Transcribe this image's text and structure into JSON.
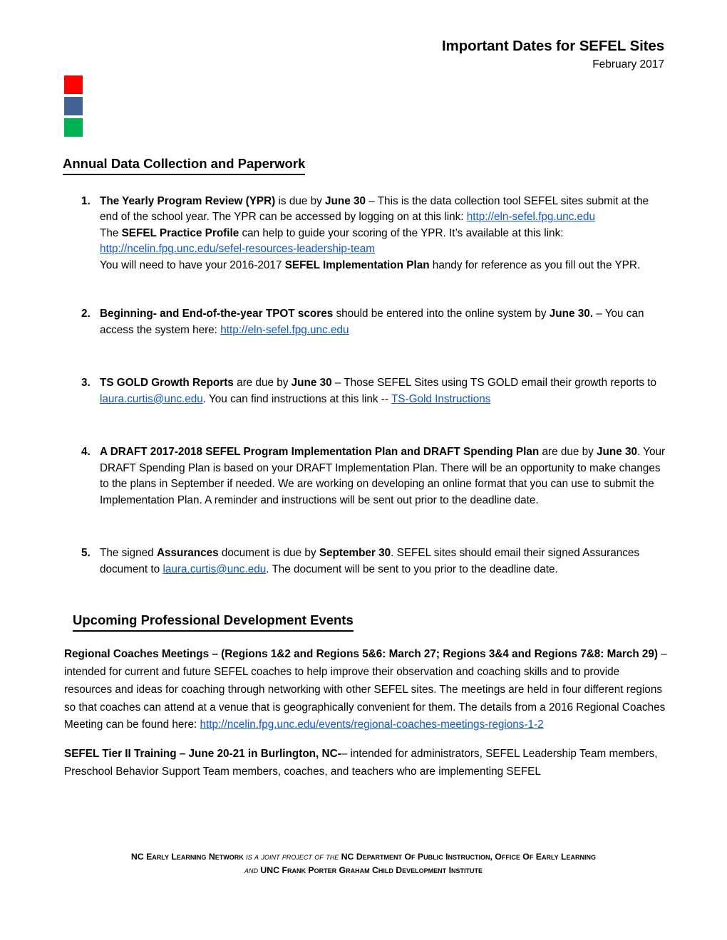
{
  "header": {
    "title": "Important Dates for SEFEL Sites",
    "subtitle": "February 2017"
  },
  "logo": {
    "colors": [
      "#FF0000",
      "#426393",
      "#00B257"
    ],
    "names": [
      "logo-block-red",
      "logo-block-blue",
      "logo-block-green"
    ]
  },
  "sections": {
    "annual": {
      "heading": "Annual Data Collection and Paperwork",
      "items": [
        {
          "number": "1.",
          "lead": "The Yearly Program Review (YPR)",
          "t1": " is due by ",
          "b1": "June 30",
          "t2": " – This is the data collection tool SEFEL sites submit at the end of the school year. The YPR can be accessed by logging on at this link: ",
          "link1": "http://eln-sefel.fpg.unc.edu",
          "t3": "The ",
          "b2": "SEFEL Practice Profile",
          "t4": " can help to guide your scoring of the YPR.  It’s available at this link:",
          "link2": "http://ncelin.fpg.unc.edu/sefel-resources-leadership-team",
          "t5": "You will need to have your 2016-2017 ",
          "b3": "SEFEL Implementation Plan",
          "t6": " handy for reference as you fill out the YPR."
        },
        {
          "number": "2.",
          "b1": "Beginning- and End-of-the-year TPOT scores",
          "t1": " should be entered into the online system by ",
          "b2": "June 30.",
          "t2": " – You can access the system here: ",
          "link1": "http://eln-sefel.fpg.unc.edu"
        },
        {
          "number": "3.",
          "b1": "TS GOLD Growth Reports",
          "t1": " are due by ",
          "b2": "June 30",
          "t2": " – Those SEFEL Sites using TS GOLD email their growth reports to ",
          "link1": "laura.curtis@unc.edu",
          "t3": ".  You can find instructions at this link -- ",
          "link2": "TS-Gold Instructions"
        },
        {
          "number": "4.",
          "b1": "A DRAFT 2017-2018 SEFEL Program Implementation Plan and DRAFT Spending Plan",
          "t1": " are due by ",
          "b2": "June 30",
          "t2": ". Your DRAFT Spending Plan is based on your DRAFT Implementation Plan. There will be an opportunity to make changes to the plans in September if needed. We are working on developing an online format that you can use to submit the Implementation Plan. A reminder and instructions will be sent out prior to the deadline date."
        },
        {
          "number": "5.",
          "t1": "The signed ",
          "b1": "Assurances",
          "t2": " document is due by ",
          "b2": "September 30",
          "t3": ". SEFEL sites should email their signed Assurances document to ",
          "link1": "laura.curtis@unc.edu",
          "t4": ". The document will be sent to you prior to the deadline date."
        }
      ]
    },
    "events": {
      "heading": "Upcoming Professional Development Events",
      "paragraphs": [
        {
          "b1": "Regional Coaches Meetings – (Regions 1&2 and Regions 5&6: March 27; Regions 3&4 and Regions 7&8: March 29)",
          "t1": " – intended for current and future SEFEL coaches to help improve their observation and coaching skills and to provide resources and ideas for coaching through networking with other SEFEL sites. The meetings are held in four different regions so that coaches can attend at a venue that is geographically convenient for them. The details from a 2016 Regional Coaches Meeting can be found here:  ",
          "link1": "http://ncelin.fpg.unc.edu/events/regional-coaches-meetings-regions-1-2"
        },
        {
          "b1": "SEFEL Tier II Training – June 20-21 in Burlington, NC-",
          "t1": "– intended for administrators, SEFEL Leadership Team members, Preschool Behavior Support Team members, coaches, and teachers who are implementing SEFEL"
        }
      ]
    }
  },
  "footer": {
    "line1_a": "NC Early Learning Network ",
    "line1_it": "is a joint project of the ",
    "line1_b": "NC Department Of Public Instruction, Office Of Early Learning",
    "line2_it": "and ",
    "line2_b": "UNC Frank Porter Graham Child Development Institute"
  }
}
